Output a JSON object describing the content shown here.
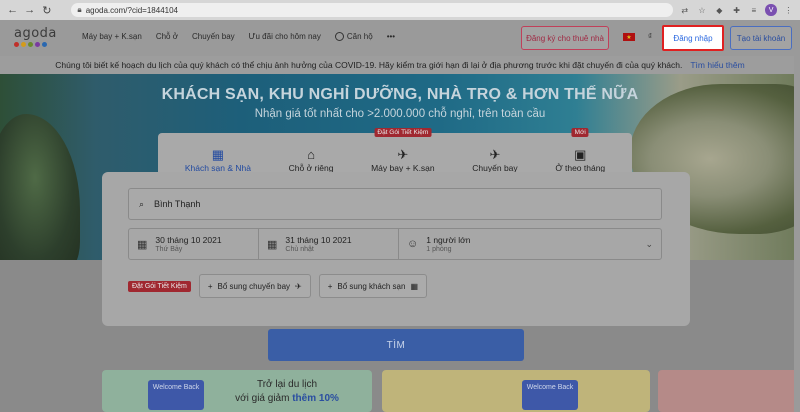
{
  "browser": {
    "url": "agoda.com/?cid=1844104",
    "avatar_letter": "V"
  },
  "header": {
    "logo_text": "agoda",
    "logo_dot_colors": [
      "#c0302a",
      "#d39b1c",
      "#6a8c2a",
      "#7a3aa0",
      "#2a68b0"
    ],
    "nav": [
      {
        "label": "Máy bay + K.sạn"
      },
      {
        "label": "Chỗ ở"
      },
      {
        "label": "Chuyến bay"
      },
      {
        "label": "Ưu đãi cho hôm nay"
      },
      {
        "label": "Căn hộ"
      }
    ],
    "more_label": "•••",
    "host_button": "Đăng ký cho thuê nhà",
    "currency": "₫",
    "login_button": "Đăng nhập",
    "signup_button": "Tạo tài khoản"
  },
  "covid_banner": {
    "text": "Chúng tôi biết kế hoạch du lịch của quý khách có thể chịu ảnh hưởng của COVID-19. Hãy kiểm tra giới hạn đi lại ở địa phương trước khi đặt chuyến đi của quý khách.",
    "link": "Tìm hiểu thêm"
  },
  "hero": {
    "title": "KHÁCH SẠN, KHU NGHỈ DƯỠNG, NHÀ TRỌ & HƠN THẾ NỮA",
    "subtitle": "Nhận giá tốt nhất cho >2.000.000 chỗ nghỉ, trên toàn cầu"
  },
  "tabs": [
    {
      "label": "Khách sạn & Nhà",
      "icon": "building-icon",
      "glyph": "▦",
      "active": true
    },
    {
      "label": "Chỗ ở riêng",
      "icon": "house-icon",
      "glyph": "⌂"
    },
    {
      "label": "Máy bay + K.sạn",
      "icon": "plane-hotel-icon",
      "glyph": "✈",
      "badge": "Đặt Gói Tiết Kiệm"
    },
    {
      "label": "Chuyến bay",
      "icon": "plane-icon",
      "glyph": "✈"
    },
    {
      "label": "Ở theo tháng",
      "icon": "calendar-icon",
      "glyph": "▣",
      "badge": "Mới"
    }
  ],
  "search": {
    "destination": "Bình Thạnh",
    "checkin_date": "30 tháng 10 2021",
    "checkin_day": "Thứ Bảy",
    "checkout_date": "31 tháng 10 2021",
    "checkout_day": "Chủ nhật",
    "guests": "1 người lớn",
    "rooms": "1 phòng",
    "save_badge": "Đặt Gói Tiết Kiệm",
    "add_flight": "Bổ sung chuyến bay",
    "add_hotel": "Bổ sung khách sạn",
    "submit": "TÌM"
  },
  "promos": [
    {
      "badge": "Welcome Back",
      "line1": "Trở lại du lịch",
      "line2_prefix": "với giá giảm ",
      "line2_bold": "thêm 10%"
    },
    {
      "badge": "Welcome Back"
    }
  ]
}
